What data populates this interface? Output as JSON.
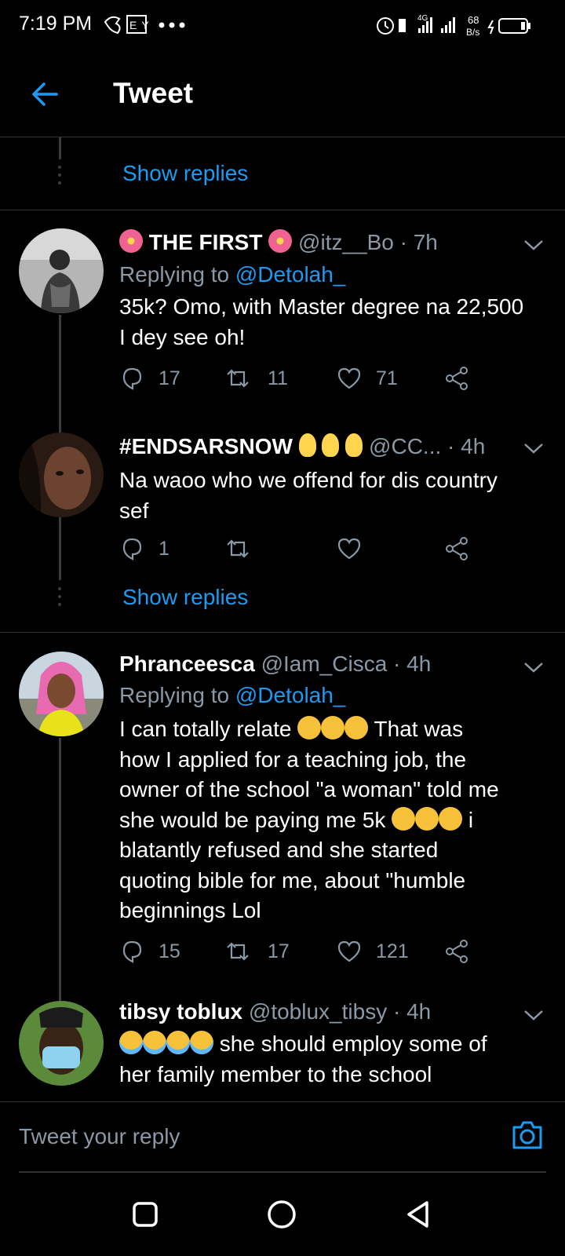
{
  "status": {
    "time": "7:19 PM",
    "net_label_top": "4G",
    "speed_value": "68",
    "speed_unit": "B/s"
  },
  "header": {
    "title": "Tweet"
  },
  "show_replies_label": "Show replies",
  "tweets": [
    {
      "name": "THE FIRST",
      "handle": "@itz__Bo",
      "time": "· 7h",
      "replying_prefix": "Replying to",
      "replying_to": "@Detolah_",
      "lines": [
        "35k? Omo, with Master degree na 22,500",
        "I dey see oh!"
      ],
      "replies": "17",
      "retweets": "11",
      "likes": "71"
    },
    {
      "name": "#ENDSARSNOW",
      "handle": "@CC...",
      "time": "· 4h",
      "lines": [
        "Na waoo who we offend for dis country",
        "sef"
      ],
      "replies": "1",
      "retweets": "",
      "likes": ""
    },
    {
      "name": "Phranceesca",
      "handle": "@Iam_Cisca",
      "time": "· 4h",
      "replying_prefix": "Replying to",
      "replying_to": "@Detolah_",
      "text_a": "I can totally relate",
      "text_b": "That was",
      "lines": [
        "how I applied for a teaching job, the",
        "owner of the school \"a woman\" told me"
      ],
      "text_c": "she would be paying me 5k",
      "text_d": "i",
      "lines2": [
        "blatantly refused and she started",
        "quoting bible for me, about \"humble",
        "beginnings Lol"
      ],
      "replies": "15",
      "retweets": "17",
      "likes": "121"
    },
    {
      "name": "tibsy toblux",
      "handle": "@toblux_tibsy",
      "time": "· 4h",
      "text_a": "she should employ some of",
      "line2": "her family member to the school"
    }
  ],
  "reply_bar": {
    "placeholder": "Tweet your reply"
  },
  "icons": {
    "back": "arrow-left-icon",
    "camera": "camera-icon",
    "reply": "reply-icon",
    "retweet": "retweet-icon",
    "like": "heart-icon",
    "share": "share-icon"
  },
  "colors": {
    "accent": "#1d9bf0",
    "muted": "#8b98a5",
    "background": "#000000"
  }
}
